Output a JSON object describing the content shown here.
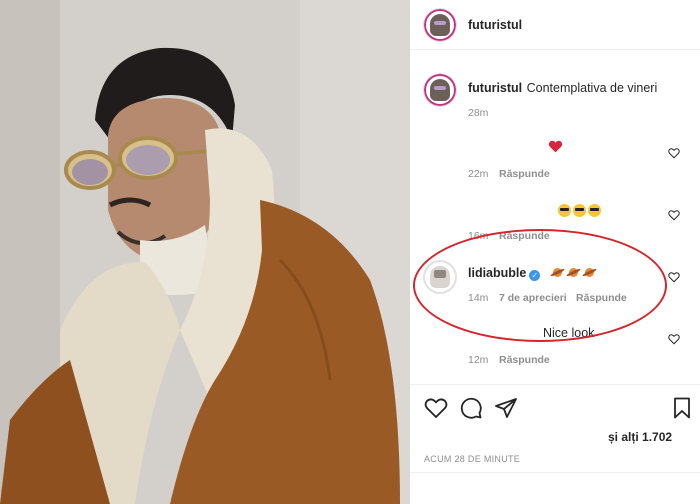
{
  "header": {
    "username": "futuristul"
  },
  "caption": {
    "username": "futuristul",
    "text": "Contemplativa de vineri",
    "time": "28m"
  },
  "comments": [
    {
      "content": "red-heart-emoji",
      "time": "22m",
      "reply_label": "Răspunde"
    },
    {
      "content": "smiling-face-with-sunglasses-emoji x3",
      "time": "16m",
      "reply_label": "Răspunde"
    },
    {
      "username": "lidiabuble",
      "content": "ringed-planet-emoji x3",
      "time": "14m",
      "likes_text": "7 de aprecieri",
      "reply_label": "Răspunde"
    },
    {
      "text": "Nice look",
      "time": "12m",
      "reply_label": "Răspunde"
    }
  ],
  "actions": {
    "icons": [
      "heart-icon",
      "comment-icon",
      "share-icon",
      "bookmark-icon"
    ]
  },
  "likes_text": "și alți 1.702",
  "timestamp": "ACUM 28 DE MINUTE",
  "colors": {
    "annotation_red": "#d4262c",
    "verified_blue": "#3897f0",
    "text": "#262626",
    "muted": "#8e8e8e"
  }
}
